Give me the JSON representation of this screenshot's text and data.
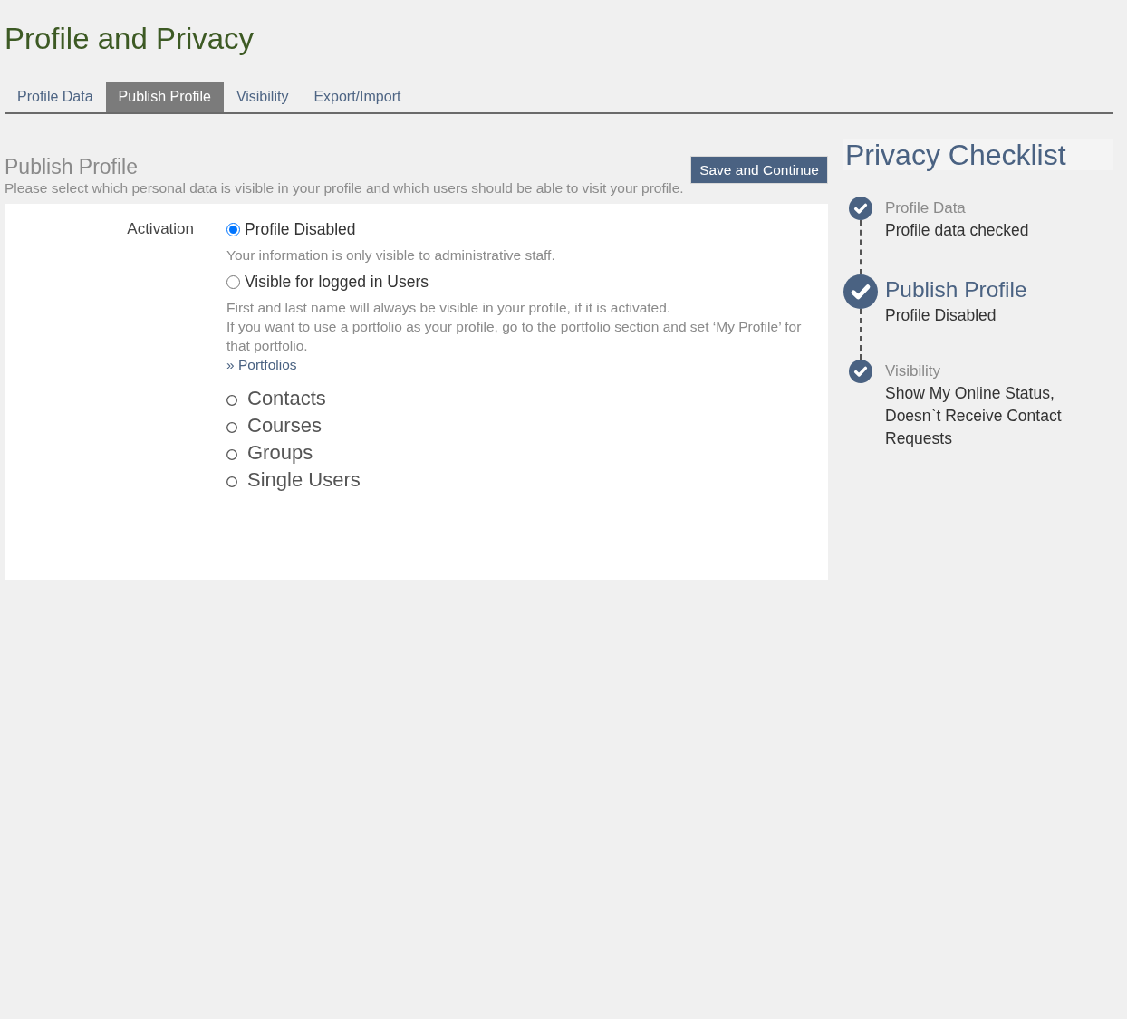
{
  "page": {
    "title": "Profile and Privacy"
  },
  "tabs": [
    {
      "label": "Profile Data",
      "selected": false
    },
    {
      "label": "Publish Profile",
      "selected": true
    },
    {
      "label": "Visibility",
      "selected": false
    },
    {
      "label": "Export/Import",
      "selected": false
    }
  ],
  "section": {
    "title": "Publish Profile",
    "description": "Please select which personal data is visible in your profile and which users should be able to visit your profile.",
    "save_button": "Save and Continue"
  },
  "form": {
    "label": "Activation",
    "options": [
      {
        "label": "Profile Disabled",
        "selected": true,
        "help": [
          "Your information is only visible to administrative staff."
        ]
      },
      {
        "label": "Visible for logged in Users",
        "selected": false,
        "help": [
          "First and last name will always be visible in your profile, if it is activated.",
          "If you want to use a portfolio as your profile, go to the portfolio section and set ‘My Profile’ for that portfolio."
        ],
        "link": "» Portfolios"
      }
    ],
    "audiences": [
      "Contacts",
      "Courses",
      "Groups",
      "Single Users"
    ]
  },
  "checklist": {
    "title": "Privacy Checklist",
    "steps": [
      {
        "title": "Profile Data",
        "status": "Profile data checked",
        "checked": true,
        "selected": false
      },
      {
        "title": "Publish Profile",
        "status": "Profile Disabled",
        "checked": true,
        "selected": true
      },
      {
        "title": "Visibility",
        "status": "Show My Online Status, Doesn`t Receive Contact Requests",
        "checked": true,
        "selected": false
      }
    ]
  }
}
